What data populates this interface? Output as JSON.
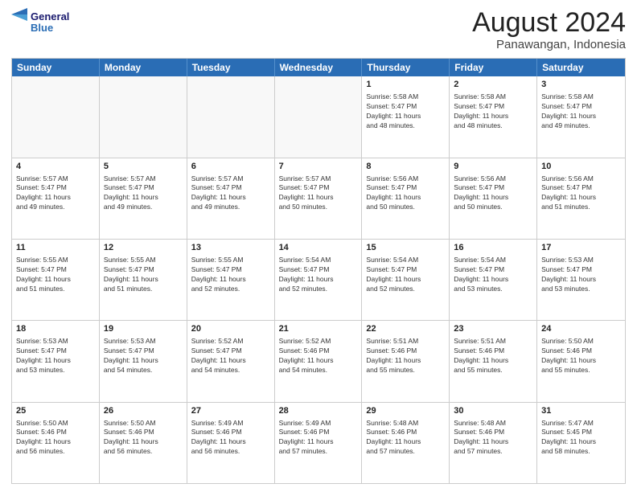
{
  "header": {
    "logo_line1": "General",
    "logo_line2": "Blue",
    "main_title": "August 2024",
    "subtitle": "Panawangan, Indonesia"
  },
  "days_of_week": [
    "Sunday",
    "Monday",
    "Tuesday",
    "Wednesday",
    "Thursday",
    "Friday",
    "Saturday"
  ],
  "rows": [
    [
      {
        "day": "",
        "empty": true
      },
      {
        "day": "",
        "empty": true
      },
      {
        "day": "",
        "empty": true
      },
      {
        "day": "",
        "empty": true
      },
      {
        "day": "1",
        "lines": [
          "Sunrise: 5:58 AM",
          "Sunset: 5:47 PM",
          "Daylight: 11 hours",
          "and 48 minutes."
        ]
      },
      {
        "day": "2",
        "lines": [
          "Sunrise: 5:58 AM",
          "Sunset: 5:47 PM",
          "Daylight: 11 hours",
          "and 48 minutes."
        ]
      },
      {
        "day": "3",
        "lines": [
          "Sunrise: 5:58 AM",
          "Sunset: 5:47 PM",
          "Daylight: 11 hours",
          "and 49 minutes."
        ]
      }
    ],
    [
      {
        "day": "4",
        "lines": [
          "Sunrise: 5:57 AM",
          "Sunset: 5:47 PM",
          "Daylight: 11 hours",
          "and 49 minutes."
        ]
      },
      {
        "day": "5",
        "lines": [
          "Sunrise: 5:57 AM",
          "Sunset: 5:47 PM",
          "Daylight: 11 hours",
          "and 49 minutes."
        ]
      },
      {
        "day": "6",
        "lines": [
          "Sunrise: 5:57 AM",
          "Sunset: 5:47 PM",
          "Daylight: 11 hours",
          "and 49 minutes."
        ]
      },
      {
        "day": "7",
        "lines": [
          "Sunrise: 5:57 AM",
          "Sunset: 5:47 PM",
          "Daylight: 11 hours",
          "and 50 minutes."
        ]
      },
      {
        "day": "8",
        "lines": [
          "Sunrise: 5:56 AM",
          "Sunset: 5:47 PM",
          "Daylight: 11 hours",
          "and 50 minutes."
        ]
      },
      {
        "day": "9",
        "lines": [
          "Sunrise: 5:56 AM",
          "Sunset: 5:47 PM",
          "Daylight: 11 hours",
          "and 50 minutes."
        ]
      },
      {
        "day": "10",
        "lines": [
          "Sunrise: 5:56 AM",
          "Sunset: 5:47 PM",
          "Daylight: 11 hours",
          "and 51 minutes."
        ]
      }
    ],
    [
      {
        "day": "11",
        "lines": [
          "Sunrise: 5:55 AM",
          "Sunset: 5:47 PM",
          "Daylight: 11 hours",
          "and 51 minutes."
        ]
      },
      {
        "day": "12",
        "lines": [
          "Sunrise: 5:55 AM",
          "Sunset: 5:47 PM",
          "Daylight: 11 hours",
          "and 51 minutes."
        ]
      },
      {
        "day": "13",
        "lines": [
          "Sunrise: 5:55 AM",
          "Sunset: 5:47 PM",
          "Daylight: 11 hours",
          "and 52 minutes."
        ]
      },
      {
        "day": "14",
        "lines": [
          "Sunrise: 5:54 AM",
          "Sunset: 5:47 PM",
          "Daylight: 11 hours",
          "and 52 minutes."
        ]
      },
      {
        "day": "15",
        "lines": [
          "Sunrise: 5:54 AM",
          "Sunset: 5:47 PM",
          "Daylight: 11 hours",
          "and 52 minutes."
        ]
      },
      {
        "day": "16",
        "lines": [
          "Sunrise: 5:54 AM",
          "Sunset: 5:47 PM",
          "Daylight: 11 hours",
          "and 53 minutes."
        ]
      },
      {
        "day": "17",
        "lines": [
          "Sunrise: 5:53 AM",
          "Sunset: 5:47 PM",
          "Daylight: 11 hours",
          "and 53 minutes."
        ]
      }
    ],
    [
      {
        "day": "18",
        "lines": [
          "Sunrise: 5:53 AM",
          "Sunset: 5:47 PM",
          "Daylight: 11 hours",
          "and 53 minutes."
        ]
      },
      {
        "day": "19",
        "lines": [
          "Sunrise: 5:53 AM",
          "Sunset: 5:47 PM",
          "Daylight: 11 hours",
          "and 54 minutes."
        ]
      },
      {
        "day": "20",
        "lines": [
          "Sunrise: 5:52 AM",
          "Sunset: 5:47 PM",
          "Daylight: 11 hours",
          "and 54 minutes."
        ]
      },
      {
        "day": "21",
        "lines": [
          "Sunrise: 5:52 AM",
          "Sunset: 5:46 PM",
          "Daylight: 11 hours",
          "and 54 minutes."
        ]
      },
      {
        "day": "22",
        "lines": [
          "Sunrise: 5:51 AM",
          "Sunset: 5:46 PM",
          "Daylight: 11 hours",
          "and 55 minutes."
        ]
      },
      {
        "day": "23",
        "lines": [
          "Sunrise: 5:51 AM",
          "Sunset: 5:46 PM",
          "Daylight: 11 hours",
          "and 55 minutes."
        ]
      },
      {
        "day": "24",
        "lines": [
          "Sunrise: 5:50 AM",
          "Sunset: 5:46 PM",
          "Daylight: 11 hours",
          "and 55 minutes."
        ]
      }
    ],
    [
      {
        "day": "25",
        "lines": [
          "Sunrise: 5:50 AM",
          "Sunset: 5:46 PM",
          "Daylight: 11 hours",
          "and 56 minutes."
        ]
      },
      {
        "day": "26",
        "lines": [
          "Sunrise: 5:50 AM",
          "Sunset: 5:46 PM",
          "Daylight: 11 hours",
          "and 56 minutes."
        ]
      },
      {
        "day": "27",
        "lines": [
          "Sunrise: 5:49 AM",
          "Sunset: 5:46 PM",
          "Daylight: 11 hours",
          "and 56 minutes."
        ]
      },
      {
        "day": "28",
        "lines": [
          "Sunrise: 5:49 AM",
          "Sunset: 5:46 PM",
          "Daylight: 11 hours",
          "and 57 minutes."
        ]
      },
      {
        "day": "29",
        "lines": [
          "Sunrise: 5:48 AM",
          "Sunset: 5:46 PM",
          "Daylight: 11 hours",
          "and 57 minutes."
        ]
      },
      {
        "day": "30",
        "lines": [
          "Sunrise: 5:48 AM",
          "Sunset: 5:46 PM",
          "Daylight: 11 hours",
          "and 57 minutes."
        ]
      },
      {
        "day": "31",
        "lines": [
          "Sunrise: 5:47 AM",
          "Sunset: 5:45 PM",
          "Daylight: 11 hours",
          "and 58 minutes."
        ]
      }
    ]
  ]
}
